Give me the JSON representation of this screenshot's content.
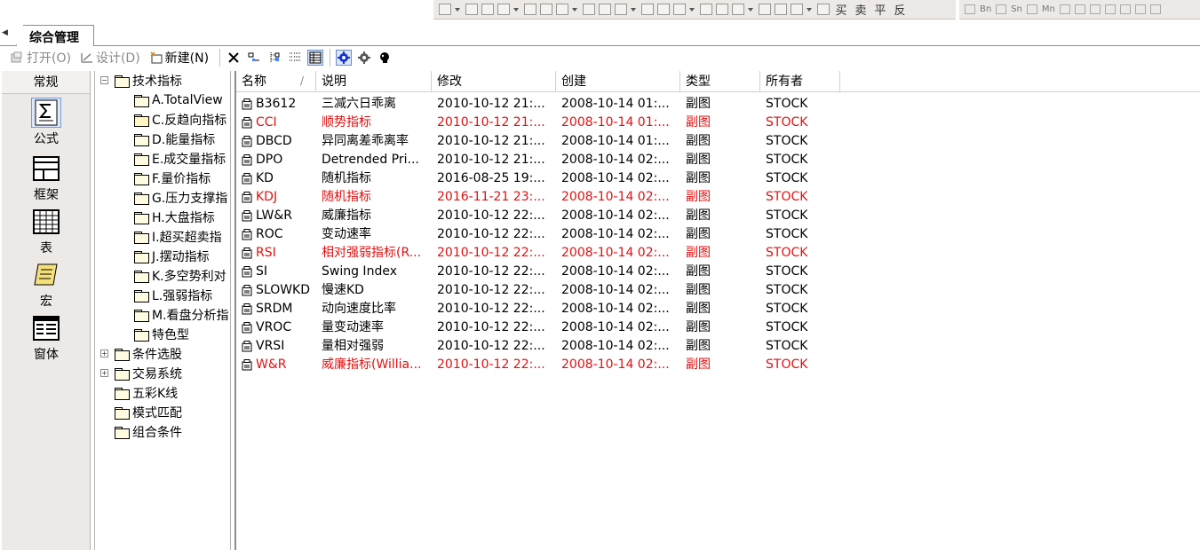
{
  "tab": {
    "title": "综合管理"
  },
  "toolbar": {
    "open_label": "打开(O)",
    "design_label": "设计(D)",
    "new_label": "新建(N)"
  },
  "draw_tools": {
    "chars": [
      "买",
      "卖",
      "平",
      "反"
    ]
  },
  "period_tools": [
    "Bn",
    "Sn",
    "Mn"
  ],
  "categories": {
    "header": "常规",
    "items": [
      {
        "label": "公式",
        "icon": "sigma-icon",
        "selected": true
      },
      {
        "label": "框架",
        "icon": "frame-icon",
        "selected": false
      },
      {
        "label": "表",
        "icon": "table-icon",
        "selected": false
      },
      {
        "label": "宏",
        "icon": "scroll-icon",
        "selected": false
      },
      {
        "label": "窗体",
        "icon": "form-icon",
        "selected": false
      }
    ]
  },
  "tree": [
    {
      "label": "技术指标",
      "level": 0,
      "expander": "−"
    },
    {
      "label": "A.TotalView",
      "level": 1
    },
    {
      "label": "C.反趋向指标",
      "level": 1,
      "open": true
    },
    {
      "label": "D.能量指标",
      "level": 1
    },
    {
      "label": "E.成交量指标",
      "level": 1
    },
    {
      "label": "F.量价指标",
      "level": 1
    },
    {
      "label": "G.压力支撑指",
      "level": 1
    },
    {
      "label": "H.大盘指标",
      "level": 1
    },
    {
      "label": "I.超买超卖指",
      "level": 1
    },
    {
      "label": "J.摆动指标",
      "level": 1
    },
    {
      "label": "K.多空势利对",
      "level": 1
    },
    {
      "label": "L.强弱指标",
      "level": 1
    },
    {
      "label": "M.看盘分析指",
      "level": 1
    },
    {
      "label": "特色型",
      "level": 1
    },
    {
      "label": "条件选股",
      "level": 0,
      "expander": "+"
    },
    {
      "label": "交易系统",
      "level": 0,
      "expander": "+"
    },
    {
      "label": "五彩K线",
      "level": 0
    },
    {
      "label": "模式匹配",
      "level": 0
    },
    {
      "label": "组合条件",
      "level": 0
    }
  ],
  "grid": {
    "columns": [
      "名称",
      "说明",
      "修改",
      "创建",
      "类型",
      "所有者"
    ],
    "rows": [
      {
        "name": "B3612",
        "desc": "三减六日乖离",
        "modified": "2010-10-12 21:...",
        "created": "2008-10-14 01:...",
        "type": "副图",
        "owner": "STOCK",
        "red": false
      },
      {
        "name": "CCI",
        "desc": "顺势指标",
        "modified": "2010-10-12 21:...",
        "created": "2008-10-14 01:...",
        "type": "副图",
        "owner": "STOCK",
        "red": true
      },
      {
        "name": "DBCD",
        "desc": "异同离差乖离率",
        "modified": "2010-10-12 21:...",
        "created": "2008-10-14 01:...",
        "type": "副图",
        "owner": "STOCK",
        "red": false
      },
      {
        "name": "DPO",
        "desc": "Detrended Pri...",
        "modified": "2010-10-12 21:...",
        "created": "2008-10-14 02:...",
        "type": "副图",
        "owner": "STOCK",
        "red": false
      },
      {
        "name": "KD",
        "desc": "随机指标",
        "modified": "2016-08-25 19:...",
        "created": "2008-10-14 02:...",
        "type": "副图",
        "owner": "STOCK",
        "red": false
      },
      {
        "name": "KDJ",
        "desc": "随机指标",
        "modified": "2016-11-21 23:...",
        "created": "2008-10-14 02:...",
        "type": "副图",
        "owner": "STOCK",
        "red": true
      },
      {
        "name": "LW&R",
        "desc": "威廉指标",
        "modified": "2010-10-12 22:...",
        "created": "2008-10-14 02:...",
        "type": "副图",
        "owner": "STOCK",
        "red": false
      },
      {
        "name": "ROC",
        "desc": "变动速率",
        "modified": "2010-10-12 22:...",
        "created": "2008-10-14 02:...",
        "type": "副图",
        "owner": "STOCK",
        "red": false
      },
      {
        "name": "RSI",
        "desc": "相对强弱指标(R...",
        "modified": "2010-10-12 22:...",
        "created": "2008-10-14 02:...",
        "type": "副图",
        "owner": "STOCK",
        "red": true
      },
      {
        "name": "SI",
        "desc": "Swing Index",
        "modified": "2010-10-12 22:...",
        "created": "2008-10-14 02:...",
        "type": "副图",
        "owner": "STOCK",
        "red": false
      },
      {
        "name": "SLOWKD",
        "desc": "慢速KD",
        "modified": "2010-10-12 22:...",
        "created": "2008-10-14 02:...",
        "type": "副图",
        "owner": "STOCK",
        "red": false
      },
      {
        "name": "SRDM",
        "desc": "动向速度比率",
        "modified": "2010-10-12 22:...",
        "created": "2008-10-14 02:...",
        "type": "副图",
        "owner": "STOCK",
        "red": false
      },
      {
        "name": "VROC",
        "desc": "量变动速率",
        "modified": "2010-10-12 22:...",
        "created": "2008-10-14 02:...",
        "type": "副图",
        "owner": "STOCK",
        "red": false
      },
      {
        "name": "VRSI",
        "desc": "量相对强弱",
        "modified": "2010-10-12 22:...",
        "created": "2008-10-14 02:...",
        "type": "副图",
        "owner": "STOCK",
        "red": false
      },
      {
        "name": "W&R",
        "desc": "威廉指标(Willia...",
        "modified": "2010-10-12 22:...",
        "created": "2008-10-14 02:...",
        "type": "副图",
        "owner": "STOCK",
        "red": true
      }
    ]
  },
  "colors": {
    "highlight_red": "#e01010",
    "panel_bg": "#ece9e6",
    "selection_blue": "#dde8fb"
  }
}
